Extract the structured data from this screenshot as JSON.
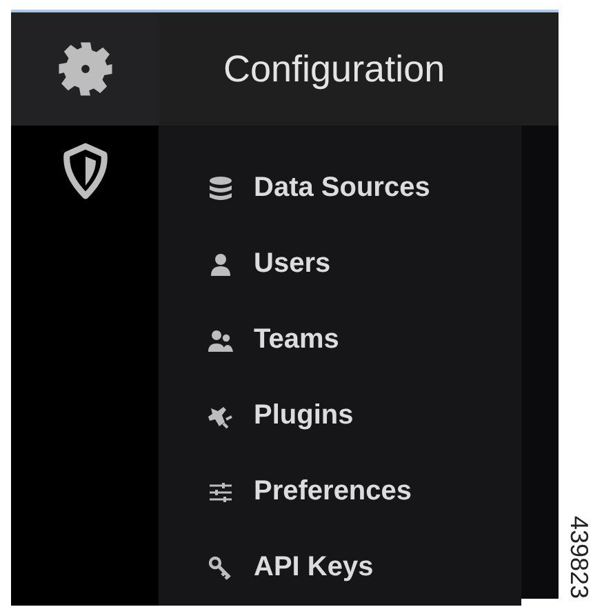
{
  "header": {
    "title": "Configuration"
  },
  "menu": [
    {
      "label": "Data Sources"
    },
    {
      "label": "Users"
    },
    {
      "label": "Teams"
    },
    {
      "label": "Plugins"
    },
    {
      "label": "Preferences"
    },
    {
      "label": "API Keys"
    }
  ],
  "figure_number": "439823"
}
